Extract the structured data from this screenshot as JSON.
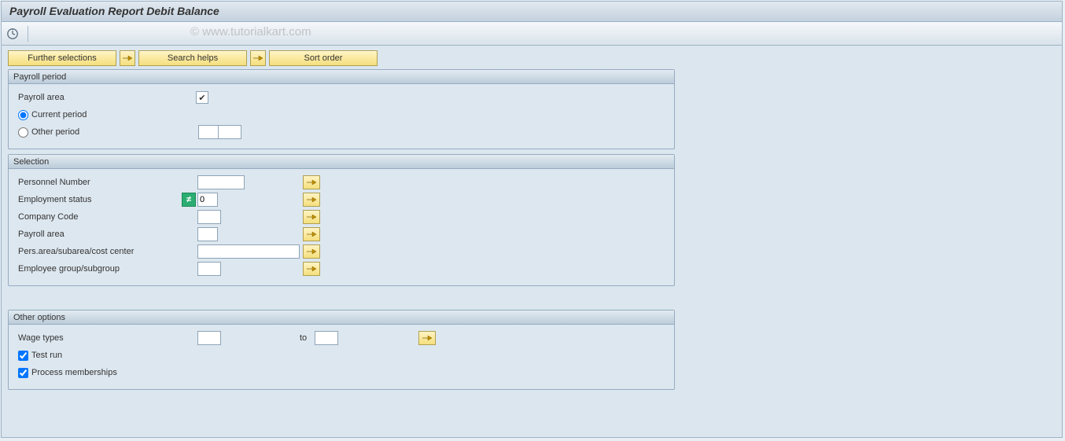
{
  "title": "Payroll Evaluation Report Debit Balance",
  "watermark": "© www.tutorialkart.com",
  "buttons": {
    "further": "Further selections",
    "search": "Search helps",
    "sort": "Sort order"
  },
  "group_payroll": {
    "title": "Payroll period",
    "payroll_area_label": "Payroll area",
    "current_period_label": "Current period",
    "other_period_label": "Other period",
    "period_selected": "current",
    "other_period_value1": "",
    "other_period_value2": ""
  },
  "group_selection": {
    "title": "Selection",
    "rows": {
      "personnel_number": {
        "label": "Personnel Number",
        "value": ""
      },
      "employment_status": {
        "label": "Employment status",
        "value": "0",
        "badge": "≠"
      },
      "company_code": {
        "label": "Company Code",
        "value": ""
      },
      "payroll_area": {
        "label": "Payroll area",
        "value": ""
      },
      "pers_area": {
        "label": "Pers.area/subarea/cost center",
        "value": ""
      },
      "employee_group": {
        "label": "Employee group/subgroup",
        "value": ""
      }
    }
  },
  "group_other": {
    "title": "Other options",
    "wage_types_label": "Wage types",
    "wage_types_from": "",
    "to_label": "to",
    "wage_types_to": "",
    "test_run_label": "Test run",
    "test_run_checked": true,
    "process_memberships_label": "Process memberships",
    "process_memberships_checked": true
  }
}
